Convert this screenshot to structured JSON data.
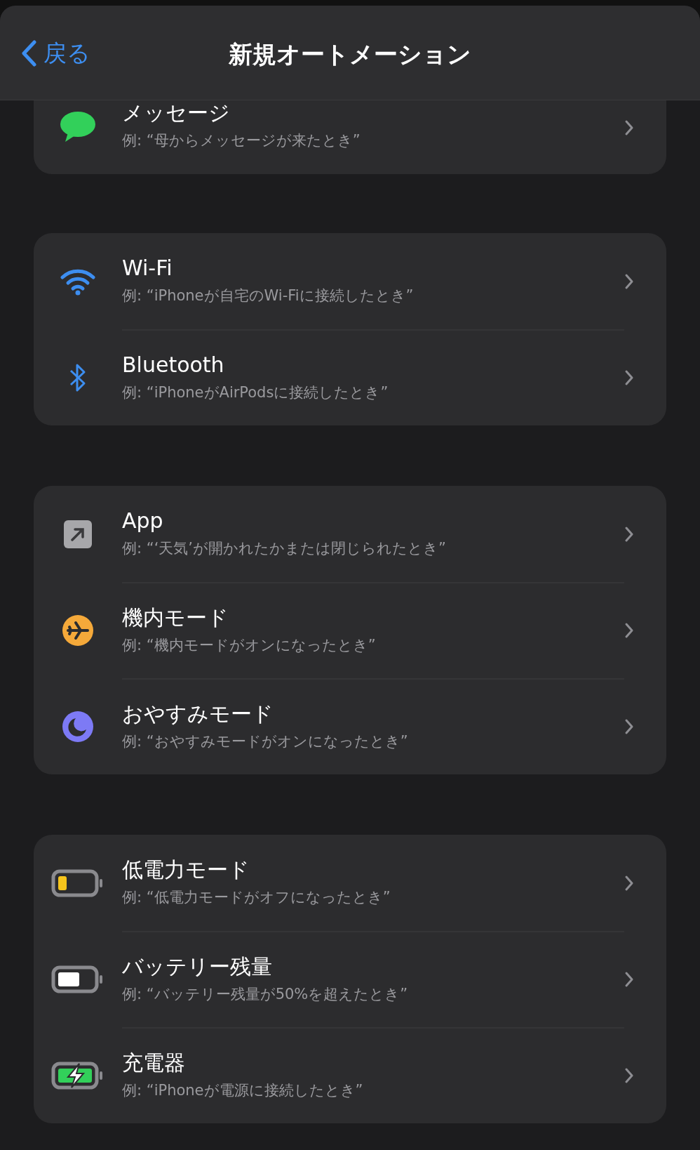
{
  "nav": {
    "back": "戻る",
    "title": "新規オートメーション"
  },
  "groups": [
    {
      "rows": [
        {
          "kind": "message",
          "title": "メッセージ",
          "example": "例: “母からメッセージが来たとき”"
        }
      ]
    },
    {
      "rows": [
        {
          "kind": "wifi",
          "title": "Wi-Fi",
          "example": "例: “iPhoneが自宅のWi-Fiに接続したとき”"
        },
        {
          "kind": "bluetooth",
          "title": "Bluetooth",
          "example": "例: “iPhoneがAirPodsに接続したとき”"
        }
      ]
    },
    {
      "rows": [
        {
          "kind": "app",
          "title": "App",
          "example": "例: “‘天気’が開かれたかまたは閉じられたとき”"
        },
        {
          "kind": "airplane",
          "title": "機内モード",
          "example": "例: “機内モードがオンになったとき”"
        },
        {
          "kind": "moon",
          "title": "おやすみモード",
          "example": "例: “おやすみモードがオンになったとき”"
        }
      ]
    },
    {
      "rows": [
        {
          "kind": "lowpower",
          "title": "低電力モード",
          "example": "例: “低電力モードがオフになったとき”"
        },
        {
          "kind": "battery",
          "title": "バッテリー残量",
          "example": "例: “バッテリー残量が50%を超えたとき”"
        },
        {
          "kind": "charger",
          "title": "充電器",
          "example": "例: “iPhoneが電源に接続したとき”"
        }
      ]
    }
  ]
}
